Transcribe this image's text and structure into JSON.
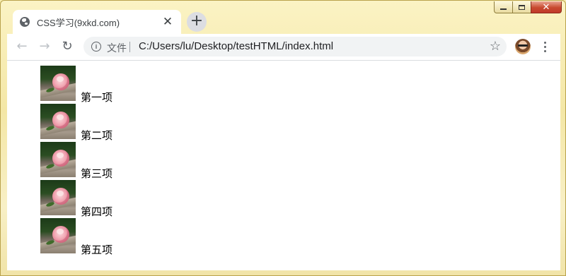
{
  "tab": {
    "title": "CSS学习(9xkd.com)",
    "close_glyph": "✕",
    "favicon": "globe-icon"
  },
  "new_tab_glyph": "+",
  "window_controls": {
    "close_glyph": "✕"
  },
  "toolbar": {
    "back_glyph": "←",
    "forward_glyph": "→",
    "reload_glyph": "↻",
    "scheme_label": "文件",
    "url": "C:/Users/lu/Desktop/testHTML/index.html",
    "bookmark_glyph": "☆"
  },
  "page": {
    "items": [
      {
        "label": "第一项",
        "image": "rose-image"
      },
      {
        "label": "第二项",
        "image": "rose-image"
      },
      {
        "label": "第三项",
        "image": "rose-image"
      },
      {
        "label": "第四项",
        "image": "rose-image"
      },
      {
        "label": "第五项",
        "image": "rose-image"
      }
    ]
  }
}
